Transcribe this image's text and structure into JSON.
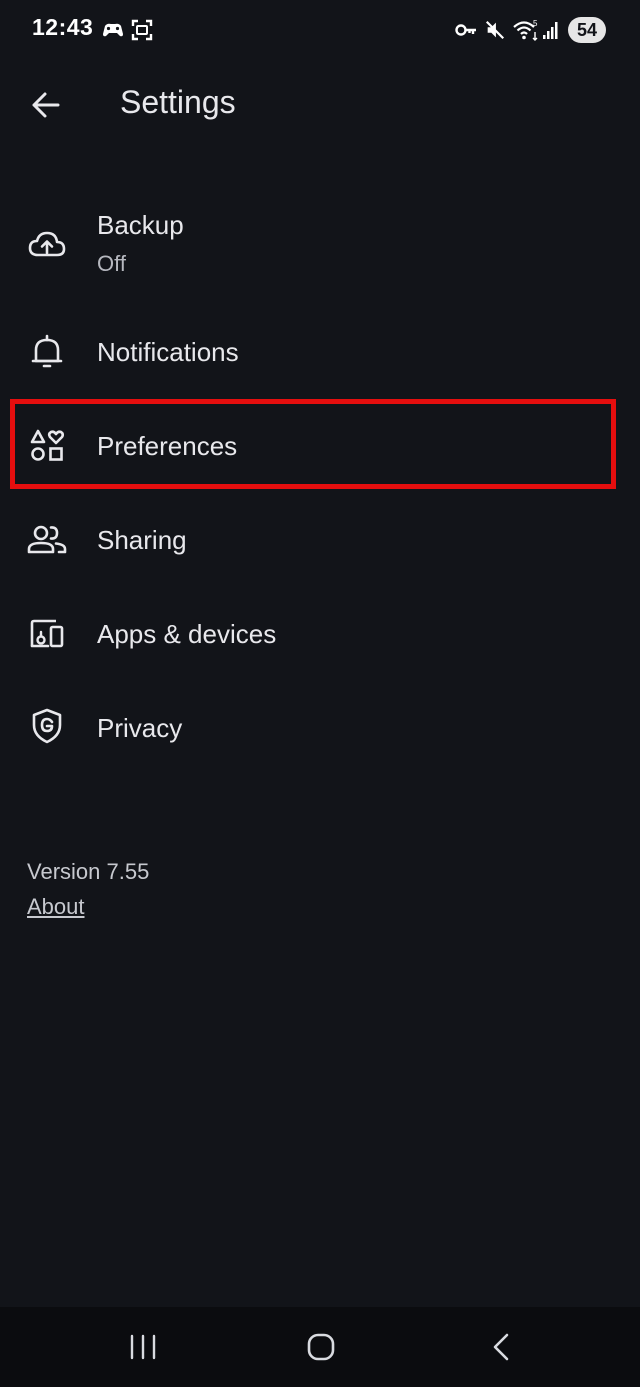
{
  "status_bar": {
    "time": "12:43",
    "battery": "54",
    "icons": [
      "game-controller-icon",
      "screenshot-icon",
      "vpn-key-icon",
      "mute-icon",
      "wifi-icon",
      "signal-icon"
    ]
  },
  "header": {
    "title": "Settings",
    "back_icon": "arrow-back-icon"
  },
  "settings_items": [
    {
      "label": "Backup",
      "sublabel": "Off",
      "icon": "cloud-upload-icon"
    },
    {
      "label": "Notifications",
      "icon": "bell-icon"
    },
    {
      "label": "Preferences",
      "icon": "shapes-heart-icon",
      "highlighted": true
    },
    {
      "label": "Sharing",
      "icon": "people-icon"
    },
    {
      "label": "Apps & devices",
      "icon": "devices-icon"
    },
    {
      "label": "Privacy",
      "icon": "shield-g-icon"
    }
  ],
  "footer": {
    "version": "Version 7.55",
    "about": "About"
  },
  "colors": {
    "background": "#121419",
    "highlight": "#e50e0e",
    "text": "#e8e8ec"
  },
  "nav_bar": {
    "icons": [
      "recents-icon",
      "home-icon",
      "back-nav-icon"
    ]
  }
}
